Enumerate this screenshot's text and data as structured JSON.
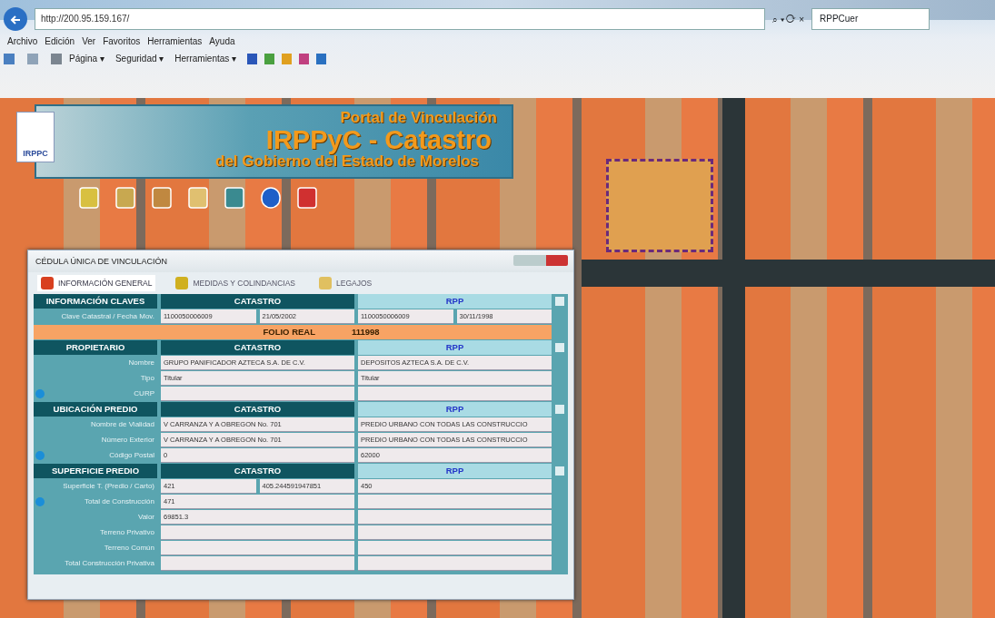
{
  "browser": {
    "address": "http://200.95.159.167/",
    "tab_title": "RPPCuer",
    "search_hint": "⌕ ▾ ⟳ ×",
    "menu": [
      "Archivo",
      "Edición",
      "Ver",
      "Favoritos",
      "Herramientas",
      "Ayuda"
    ],
    "command_bar": [
      "Página ▾",
      "Seguridad ▾",
      "Herramientas ▾"
    ]
  },
  "banner": {
    "logo_text": "IRPPC",
    "line_1": "Portal de Vinculación",
    "line_2": "IRPPyC - Catastro",
    "line_3": "del Gobierno del Estado de Morelos"
  },
  "panel": {
    "title": "CÉDULA ÚNICA DE VINCULACIÓN",
    "tabs": [
      {
        "label": "INFORMACIÓN GENERAL",
        "selected": true
      },
      {
        "label": "MEDIDAS Y COLINDANCIAS",
        "selected": false
      },
      {
        "label": "LEGAJOS",
        "selected": false
      }
    ],
    "sections": [
      {
        "kind": "section",
        "title": "INFORMACIÓN CLAVES",
        "catastro": "CATASTRO",
        "rpp": "RPP",
        "checked": false,
        "rows": [
          {
            "label": "Clave Catastral / Fecha Mov.",
            "catastro": [
              "1100050006009",
              "21/05/2002"
            ],
            "rpp": [
              "1100050006009",
              "30/11/1998"
            ],
            "expander": false
          }
        ]
      },
      {
        "kind": "folio",
        "label": "FOLIO REAL",
        "value": "111998"
      },
      {
        "kind": "section",
        "title": "PROPIETARIO",
        "catastro": "CATASTRO",
        "rpp": "RPP",
        "checked": false,
        "rows": [
          {
            "label": "Nombre",
            "catastro": [
              "GRUPO PANIFICADOR AZTECA S.A. DE C.V."
            ],
            "rpp": [
              "DEPOSITOS AZTECA S.A. DE C.V."
            ],
            "expander": false
          },
          {
            "label": "Tipo",
            "catastro": [
              "Titular"
            ],
            "rpp": [
              "Titular"
            ],
            "expander": false
          },
          {
            "label": "CURP",
            "catastro": [],
            "rpp": [],
            "expander": true
          }
        ]
      },
      {
        "kind": "section",
        "title": "UBICACIÓN PREDIO",
        "catastro": "CATASTRO",
        "rpp": "RPP",
        "checked": false,
        "rows": [
          {
            "label": "Nombre de Vialidad",
            "catastro": [
              "V CARRANZA Y A OBREGON No. 701"
            ],
            "rpp": [
              "PREDIO URBANO CON TODAS LAS CONSTRUCCIO"
            ],
            "expander": false
          },
          {
            "label": "Número Exterior",
            "catastro": [
              "V CARRANZA Y A OBREGON No. 701"
            ],
            "rpp": [
              "PREDIO URBANO CON TODAS LAS CONSTRUCCIO"
            ],
            "expander": false
          },
          {
            "label": "Código Postal",
            "catastro": [
              "0"
            ],
            "rpp": [
              "62000"
            ],
            "expander": true
          }
        ]
      },
      {
        "kind": "section",
        "title": "SUPERFICIE PREDIO",
        "catastro": "CATASTRO",
        "rpp": "RPP",
        "checked": false,
        "rows": [
          {
            "label": "Superficie T. (Predio / Carto)",
            "catastro": [
              "421",
              "405.244591947851"
            ],
            "rpp": [
              "450"
            ],
            "expander": false
          },
          {
            "label": "Total de Construcción",
            "catastro": [
              "471"
            ],
            "rpp": [],
            "expander": true
          },
          {
            "label": "Valor",
            "catastro": [
              "69851.3"
            ],
            "rpp": [],
            "expander": false
          },
          {
            "label": "Terreno Privativo",
            "catastro": [],
            "rpp": [],
            "expander": false
          },
          {
            "label": "Terreno Común",
            "catastro": [],
            "rpp": [],
            "expander": false
          },
          {
            "label": "Total Construcción Privativa",
            "catastro": [],
            "rpp": [],
            "expander": false
          }
        ]
      }
    ]
  }
}
